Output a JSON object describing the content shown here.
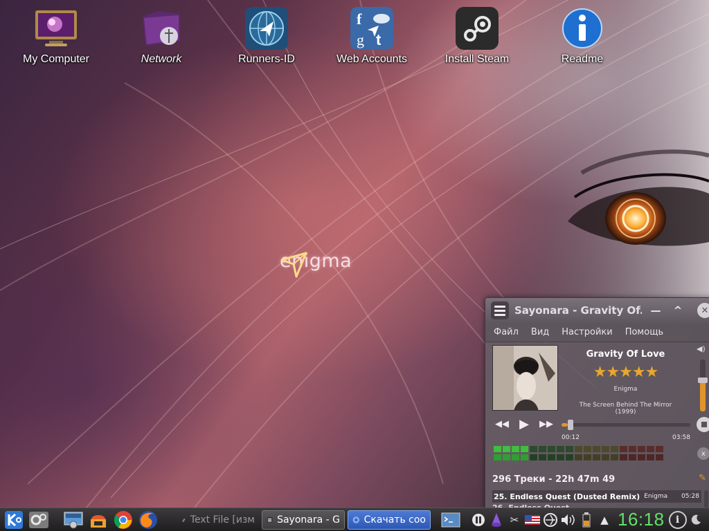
{
  "desktop": {
    "brand": {
      "logo_text": "enigma"
    },
    "icons": [
      {
        "label": "My Computer",
        "icon": "computer-icon"
      },
      {
        "label": "Network",
        "icon": "network-folder-icon"
      },
      {
        "label": "Runners-ID",
        "icon": "runners-id-icon"
      },
      {
        "label": "Web Accounts",
        "icon": "web-accounts-icon"
      },
      {
        "label": "Install Steam",
        "icon": "steam-icon"
      },
      {
        "label": "Readme",
        "icon": "info-icon"
      }
    ]
  },
  "player": {
    "window_title": "Sayonara - Gravity Of...",
    "menu": [
      "Файл",
      "Вид",
      "Настройки",
      "Помощь"
    ],
    "now_playing": {
      "title": "Gravity Of Love",
      "rating_stars": "★★★★★",
      "rating": 5,
      "artist": "Enigma",
      "album": "The Screen Behind The Mirror (1999)",
      "current_time": "00:12",
      "total_time": "03:58",
      "progress": 0.05,
      "volume": 0.6
    },
    "playlist": {
      "summary": "296 Треки - 22h 47m 49",
      "rows": [
        {
          "title": "25. Endless Quest (Dusted Remix)",
          "artist": "Enigma",
          "duration": "05:28"
        },
        {
          "title": "26. Endless Quest",
          "artist": "",
          "duration": ""
        }
      ]
    }
  },
  "taskbar": {
    "launchers": [
      "kde-menu-icon",
      "system-settings-icon",
      "screenshot-icon",
      "package-manager-icon",
      "chrome-icon",
      "firefox-icon"
    ],
    "tasks": [
      {
        "label": "Text File [изм",
        "icon": "text-editor-icon",
        "state": "inactive"
      },
      {
        "label": "Sayonara - G",
        "icon": "sayonara-icon",
        "state": "active"
      },
      {
        "label": "Скачать соо",
        "icon": "browser-icon",
        "state": "highlighted"
      }
    ],
    "tray": [
      "terminal-icon",
      "pause-icon",
      "wizard-icon",
      "scissors-icon",
      "us-flag-icon",
      "network-icon",
      "volume-icon",
      "battery-icon",
      "expand-tray-icon"
    ],
    "clock": "16:18"
  },
  "colors": {
    "accent": "#e0952c",
    "clock": "#62e06a",
    "task_highlight": "#3d68c6"
  }
}
